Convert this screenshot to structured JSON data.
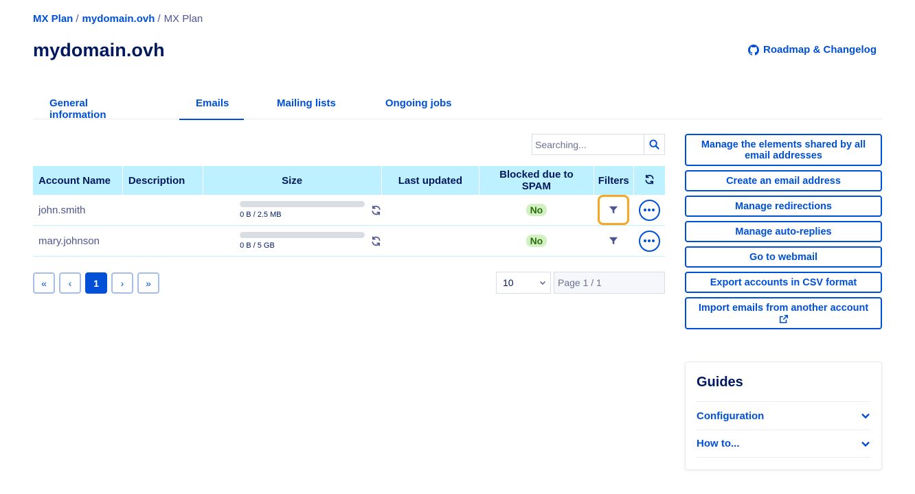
{
  "breadcrumb": {
    "items": [
      "MX Plan",
      "mydomain.ovh",
      "MX Plan"
    ],
    "separator": "/"
  },
  "page": {
    "title": "mydomain.ovh",
    "roadmap_link": "Roadmap & Changelog",
    "roadmap_icon": "github-icon"
  },
  "tabs": [
    {
      "label": "General information",
      "active": false
    },
    {
      "label": "Emails",
      "active": true
    },
    {
      "label": "Mailing lists",
      "active": false
    },
    {
      "label": "Ongoing jobs",
      "active": false
    }
  ],
  "search": {
    "placeholder": "Searching...",
    "value": "",
    "icon": "search-icon"
  },
  "table": {
    "headers": {
      "account_name": "Account Name",
      "description": "Description",
      "size": "Size",
      "last_updated": "Last updated",
      "blocked_spam": "Blocked due to SPAM",
      "filters": "Filters",
      "refresh_icon": "refresh-icon"
    },
    "rows": [
      {
        "account": "john.smith",
        "description": "",
        "size_text": "0 B / 2.5 MB",
        "usage": 0,
        "last_updated": "",
        "blocked_spam": "No",
        "filter_focused": true
      },
      {
        "account": "mary.johnson",
        "description": "",
        "size_text": "0 B / 5 GB",
        "usage": 0,
        "last_updated": "",
        "blocked_spam": "No",
        "filter_focused": false
      }
    ]
  },
  "pagination": {
    "first": "«",
    "prev": "‹",
    "current": "1",
    "next": "›",
    "last": "»",
    "page_size": "10",
    "page_indicator": "Page 1 / 1"
  },
  "actions": {
    "manage_shared": "Manage the elements shared by all email addresses",
    "create_email": "Create an email address",
    "manage_redirections": "Manage redirections",
    "manage_autoreplies": "Manage auto-replies",
    "webmail": "Go to webmail",
    "export_csv": "Export accounts in CSV format",
    "import_emails": "Import emails from another account"
  },
  "guides": {
    "title": "Guides",
    "items": [
      "Configuration",
      "How to..."
    ]
  },
  "colors": {
    "primary": "#0050d7",
    "heading": "#00185e",
    "table_header_bg": "#bef1ff",
    "badge_bg": "#d2f0c2",
    "focus_ring": "#f7a626"
  }
}
